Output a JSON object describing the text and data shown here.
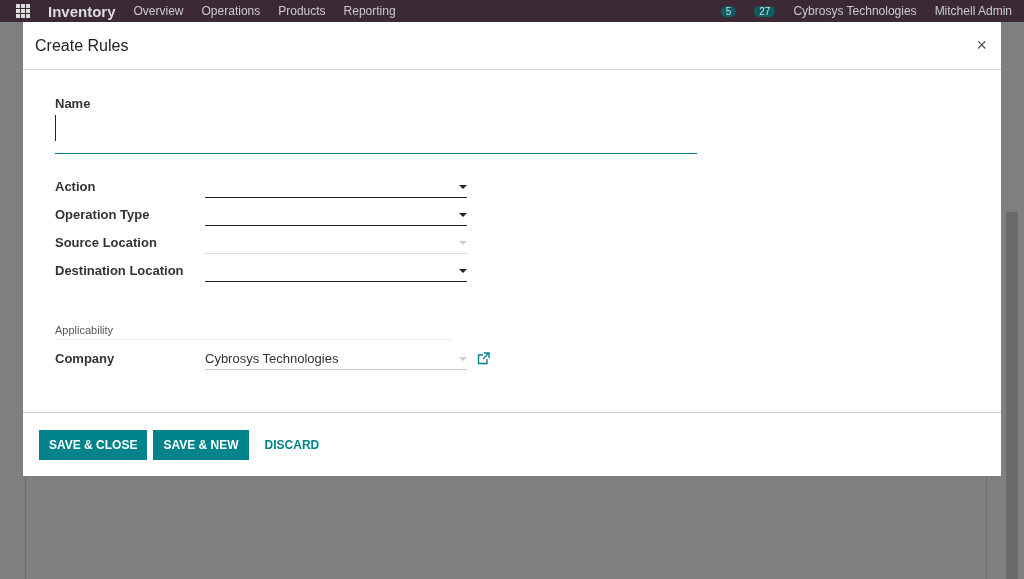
{
  "top_bar": {
    "app": "Inventory",
    "menu": [
      "Overview",
      "Operations",
      "Products",
      "Reporting"
    ],
    "badges": [
      {
        "count": "5"
      },
      {
        "count": "27"
      }
    ],
    "company": "Cybrosys Technologies",
    "user": "Mitchell Admin"
  },
  "dialog": {
    "title": "Create Rules",
    "close": "×"
  },
  "name_field": {
    "label": "Name",
    "focused": true
  },
  "fields": [
    {
      "label": "Action",
      "disabled": false
    },
    {
      "label": "Operation Type",
      "disabled": false
    },
    {
      "label": "Source Location",
      "disabled": true
    },
    {
      "label": "Destination Location",
      "disabled": false
    }
  ],
  "applicability": {
    "title": "Applicability",
    "company_label": "Company",
    "company_value": "Cybrosys Technologies"
  },
  "buttons": [
    {
      "label": "SAVE & CLOSE",
      "kind": "primary"
    },
    {
      "label": "SAVE & NEW",
      "kind": "primary"
    },
    {
      "label": "DISCARD",
      "kind": "link"
    }
  ]
}
